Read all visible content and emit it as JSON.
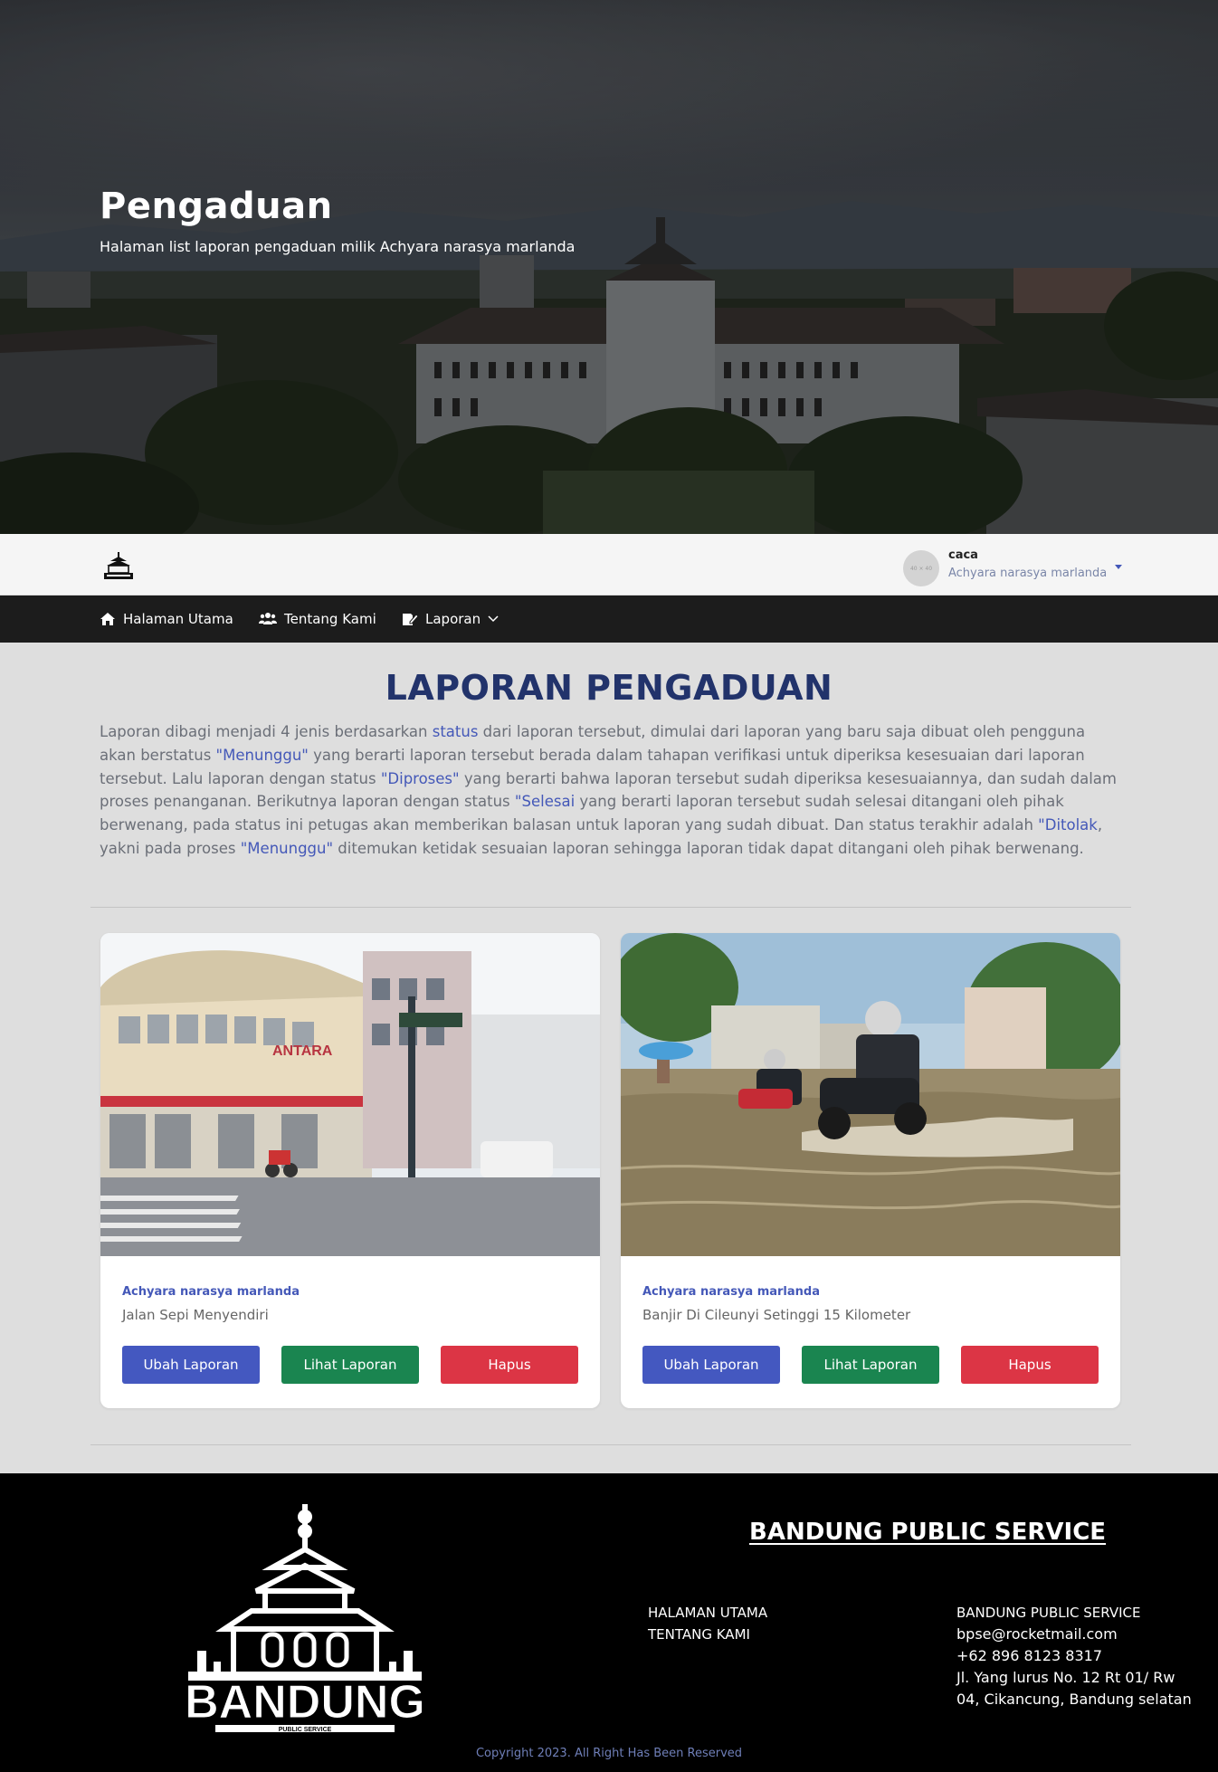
{
  "hero": {
    "title": "Pengaduan",
    "subtitle": "Halaman list laporan pengaduan milik Achyara narasya marlanda"
  },
  "topbar": {
    "avatar_placeholder": "40 × 40",
    "user_name": "caca",
    "user_fullname": "Achyara narasya marlanda"
  },
  "nav": {
    "items": [
      {
        "label": "Halaman Utama",
        "icon": "home-icon"
      },
      {
        "label": "Tentang Kami",
        "icon": "users-icon"
      },
      {
        "label": "Laporan",
        "icon": "edit-report-icon",
        "has_dropdown": true
      }
    ]
  },
  "main": {
    "title": "LAPORAN PENGADUAN",
    "intro": [
      {
        "text": "Laporan dibagi menjadi 4 jenis berdasarkan "
      },
      {
        "text": "status",
        "highlight": true
      },
      {
        "text": " dari laporan tersebut, dimulai dari laporan yang baru saja dibuat oleh pengguna akan berstatus "
      },
      {
        "text": "\"Menunggu\"",
        "highlight": true
      },
      {
        "text": " yang berarti laporan tersebut berada dalam tahapan verifikasi untuk diperiksa kesesuaian dari laporan tersebut. Lalu laporan dengan status "
      },
      {
        "text": "\"Diproses\"",
        "highlight": true
      },
      {
        "text": " yang berarti bahwa laporan tersebut sudah diperiksa kesesuaiannya, dan sudah dalam proses penanganan. Berikutnya laporan dengan status "
      },
      {
        "text": "\"Selesai",
        "highlight": true
      },
      {
        "text": " yang berarti laporan tersebut sudah selesai ditangani oleh pihak berwenang, pada status ini petugas akan memberikan balasan untuk laporan yang sudah dibuat. Dan status terakhir adalah "
      },
      {
        "text": "\"Ditolak",
        "highlight": true
      },
      {
        "text": ", yakni pada proses "
      },
      {
        "text": "\"Menunggu\"",
        "highlight": true
      },
      {
        "text": " ditemukan ketidak sesuaian laporan sehingga laporan tidak dapat ditangani oleh pihak berwenang."
      }
    ]
  },
  "cards": [
    {
      "author": "Achyara narasya marlanda",
      "title": "Jalan Sepi Menyendiri",
      "image": "street-corner-braga",
      "edit_label": "Ubah Laporan",
      "view_label": "Lihat Laporan",
      "delete_label": "Hapus"
    },
    {
      "author": "Achyara narasya marlanda",
      "title": "Banjir Di Cileunyi Setinggi 15 Kilometer",
      "image": "flooded-street",
      "edit_label": "Ubah Laporan",
      "view_label": "Lihat Laporan",
      "delete_label": "Hapus"
    }
  ],
  "footer": {
    "logo_text": "BANDUNG",
    "logo_subtext": "PUBLIC SERVICE",
    "brand": "BANDUNG PUBLIC SERVICE",
    "links": [
      "HALAMAN UTAMA",
      "TENTANG KAMI"
    ],
    "contact": {
      "name": "BANDUNG PUBLIC SERVICE",
      "email": "bpse@rocketmail.com",
      "phone": "+62 896 8123 8317",
      "address": "Jl. Yang lurus No. 12 Rt 01/ Rw 04, Cikancung, Bandung selatan"
    },
    "copyright": "Copyright 2023. All Right Has Been Reserved"
  },
  "colors": {
    "accent": "#4458b8",
    "title": "#22336b",
    "success": "#1a8550",
    "danger": "#dc3545",
    "nav_bg": "#1c1c1c"
  }
}
